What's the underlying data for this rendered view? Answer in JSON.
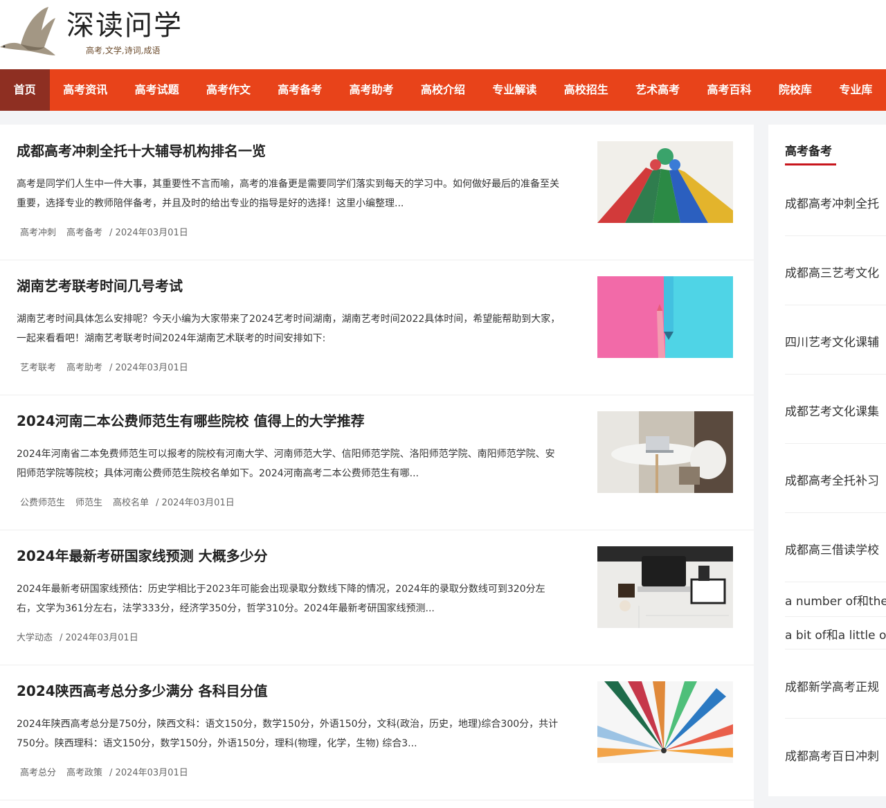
{
  "site": {
    "title": "深读问学",
    "subtitle": "高考,文学,诗词,成语"
  },
  "nav": [
    {
      "label": "首页",
      "active": true
    },
    {
      "label": "高考资讯"
    },
    {
      "label": "高考试题"
    },
    {
      "label": "高考作文"
    },
    {
      "label": "高考备考"
    },
    {
      "label": "高考助考"
    },
    {
      "label": "高校介绍"
    },
    {
      "label": "专业解读"
    },
    {
      "label": "高校招生"
    },
    {
      "label": "艺术高考"
    },
    {
      "label": "高考百科"
    },
    {
      "label": "院校库"
    },
    {
      "label": "专业库"
    }
  ],
  "articles": [
    {
      "title": "成都高考冲刺全托十大辅导机构排名一览",
      "desc": "高考是同学们人生中一件大事，其重要性不言而喻，高考的准备更是需要同学们落实到每天的学习中。如何做好最后的准备至关重要，选择专业的教师陪伴备考，并且及时的给出专业的指导是好的选择！这里小编整理...",
      "tags": [
        "高考冲刺",
        "高考备考"
      ],
      "date": "/ 2024年03月01日",
      "image": "colored-pencils-tips"
    },
    {
      "title": "湖南艺考联考时间几号考试",
      "desc": "湖南艺考时间具体怎么安排呢？今天小编为大家带来了2024艺考时间湖南，湖南艺考时间2022具体时间，希望能帮助到大家，一起来看看吧！湖南艺考联考时间2024年湖南艺术联考的时间安排如下:",
      "tags": [
        "艺考联考",
        "高考助考"
      ],
      "date": "/ 2024年03月01日",
      "image": "pink-blue-pencils"
    },
    {
      "title": "2024河南二本公费师范生有哪些院校 值得上的大学推荐",
      "desc": "2024年河南省二本免费师范生可以报考的院校有河南大学、河南师范大学、信阳师范学院、洛阳师范学院、南阳师范学院、安阳师范学院等院校；具体河南公费师范生院校名单如下。2024河南高考二本公费师范生有哪...",
      "tags": [
        "公费师范生",
        "师范生",
        "高校名单"
      ],
      "date": "/ 2024年03月01日",
      "image": "desk-laptop-room"
    },
    {
      "title": "2024年最新考研国家线预测 大概多少分",
      "desc": "2024年最新考研国家线预估：历史学相比于2023年可能会出现录取分数线下降的情况，2024年的录取分数线可到320分左右，文学为361分左右，法学333分，经济学350分，哲学310分。2024年最新考研国家线预测...",
      "tags": [
        "大学动态"
      ],
      "date": "/ 2024年03月01日",
      "image": "marble-desk-laptop"
    },
    {
      "title": "2024陕西高考总分多少满分 各科目分值",
      "desc": "2024年陕西高考总分是750分，陕西文科：语文150分，数学150分，外语150分，文科(政治，历史，地理)综合300分，共计750分。陕西理科：语文150分，数学150分，外语150分，理科(物理，化学，生物) 综合3...",
      "tags": [
        "高考总分",
        "高考政策"
      ],
      "date": "/ 2024年03月01日",
      "image": "pencils-circle"
    }
  ],
  "sidebar": {
    "title": "高考备考",
    "items": [
      "成都高考冲刺全托",
      "成都高三艺考文化",
      "四川艺考文化课辅",
      "成都艺考文化课集",
      "成都高考全托补习",
      "成都高三借读学校",
      "a number of和the",
      "a bit of和a little o",
      "成都新学高考正规",
      "成都高考百日冲刺"
    ]
  },
  "colors": {
    "nav_bg": "#e8431a",
    "nav_active": "#8e2f22",
    "side_underline": "#c8161d"
  }
}
